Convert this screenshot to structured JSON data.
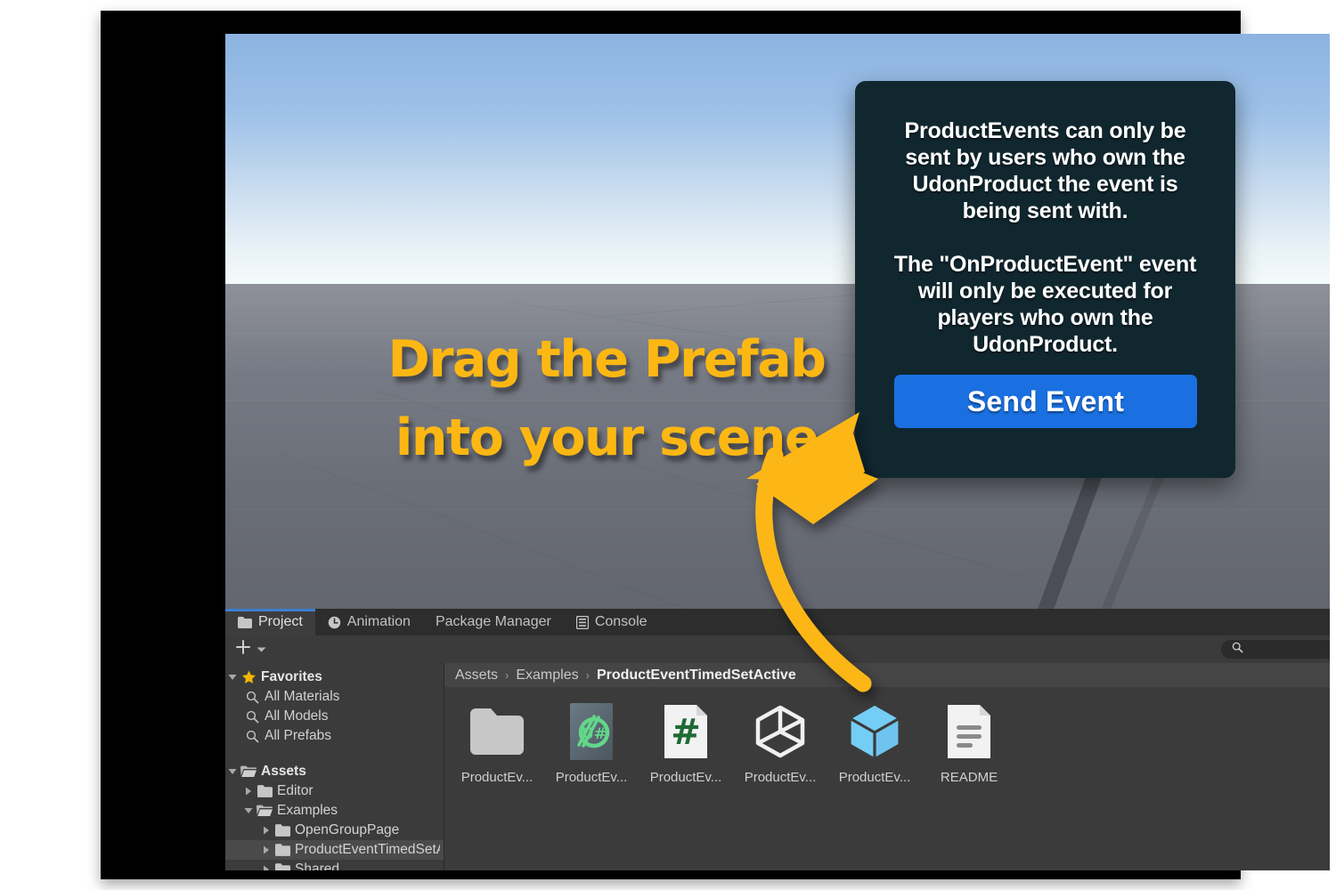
{
  "scene": {
    "annotation": {
      "line1": "Drag the Prefab",
      "line2": "into your scene",
      "color": "#fcb713"
    },
    "arrow": {
      "name": "curved-arrow",
      "color": "#fcb713"
    },
    "info_panel": {
      "paragraph1": "ProductEvents can only be sent by users who own the UdonProduct the event is being sent with.",
      "paragraph2": "The \"OnProductEvent\" event will only be executed for players who own the UdonProduct.",
      "button_label": "Send Event",
      "background": "#11272f",
      "button_color": "#1a70e0"
    }
  },
  "project_window": {
    "tabs": [
      {
        "label": "Project",
        "icon": "folder-icon",
        "active": true
      },
      {
        "label": "Animation",
        "icon": "clock-icon",
        "active": false
      },
      {
        "label": "Package Manager",
        "icon": "none",
        "active": false
      },
      {
        "label": "Console",
        "icon": "console-icon",
        "active": false
      }
    ],
    "toolbar": {
      "add_label": "+",
      "add_dropdown": "▾",
      "search_placeholder": ""
    },
    "tree": [
      {
        "label": "Favorites",
        "icon": "star-icon",
        "twisty": "▼",
        "depth": 0,
        "bold": true,
        "selected": false
      },
      {
        "label": "All Materials",
        "icon": "search-icon",
        "twisty": "",
        "depth": 1,
        "bold": false,
        "selected": false
      },
      {
        "label": "All Models",
        "icon": "search-icon",
        "twisty": "",
        "depth": 1,
        "bold": false,
        "selected": false
      },
      {
        "label": "All Prefabs",
        "icon": "search-icon",
        "twisty": "",
        "depth": 1,
        "bold": false,
        "selected": false
      },
      {
        "label": "",
        "icon": "none",
        "twisty": "",
        "depth": 0,
        "bold": false,
        "selected": false
      },
      {
        "label": "Assets",
        "icon": "folder-open-icon",
        "twisty": "▼",
        "depth": 0,
        "bold": true,
        "selected": false
      },
      {
        "label": "Editor",
        "icon": "folder-icon",
        "twisty": "▶",
        "depth": 1,
        "bold": false,
        "selected": false
      },
      {
        "label": "Examples",
        "icon": "folder-open-icon",
        "twisty": "▼",
        "depth": 1,
        "bold": false,
        "selected": false
      },
      {
        "label": "OpenGroupPage",
        "icon": "folder-icon",
        "twisty": "▶",
        "depth": 2,
        "bold": false,
        "selected": false
      },
      {
        "label": "ProductEventTimedSetActive",
        "icon": "folder-icon",
        "twisty": "▶",
        "depth": 2,
        "bold": false,
        "selected": true
      },
      {
        "label": "Shared",
        "icon": "folder-icon",
        "twisty": "▶",
        "depth": 2,
        "bold": false,
        "selected": false
      }
    ],
    "breadcrumb": {
      "items": [
        "Assets",
        "Examples",
        "ProductEventTimedSetActive"
      ],
      "separator": "›"
    },
    "assets": [
      {
        "label": "ProductEv...",
        "icon": "folder-icon"
      },
      {
        "label": "ProductEv...",
        "icon": "udonsharp-icon"
      },
      {
        "label": "ProductEv...",
        "icon": "csharp-script-icon"
      },
      {
        "label": "ProductEv...",
        "icon": "unity-scene-icon"
      },
      {
        "label": "ProductEv...",
        "icon": "prefab-cube-icon"
      },
      {
        "label": "README",
        "icon": "text-document-icon"
      }
    ]
  }
}
